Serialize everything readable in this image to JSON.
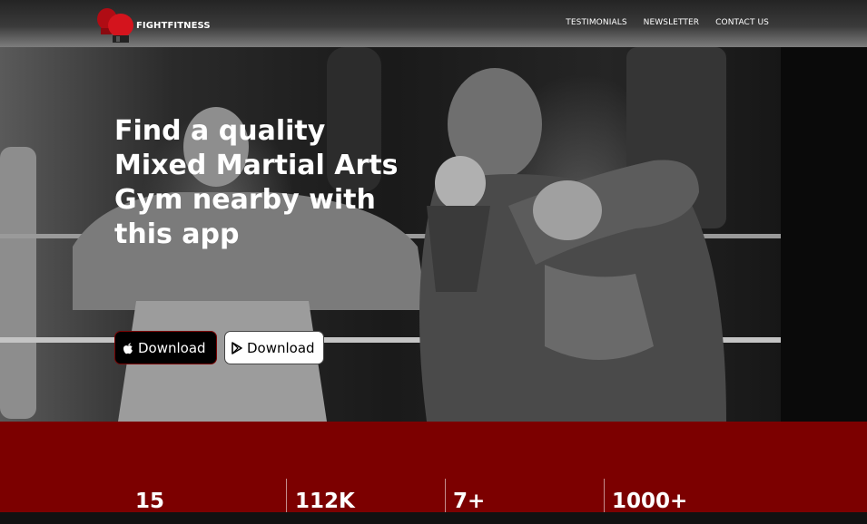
{
  "brand": {
    "name": "FIGHTFITNESS",
    "logo_icon": "boxing-gloves-icon"
  },
  "nav": {
    "links": [
      "TESTIMONIALS",
      "NEWSLETTER",
      "CONTACT US"
    ]
  },
  "hero": {
    "headline": "Find a quality Mixed Martial Arts Gym nearby with this app",
    "buttons": [
      {
        "label": "Download",
        "icon": "apple-icon"
      },
      {
        "label": "Download",
        "icon": "play-store-icon"
      }
    ]
  },
  "stats": [
    "15",
    "112K",
    "7+",
    "1000+"
  ],
  "colors": {
    "accent": "#7c0000",
    "logo_red": "#c0101a"
  }
}
